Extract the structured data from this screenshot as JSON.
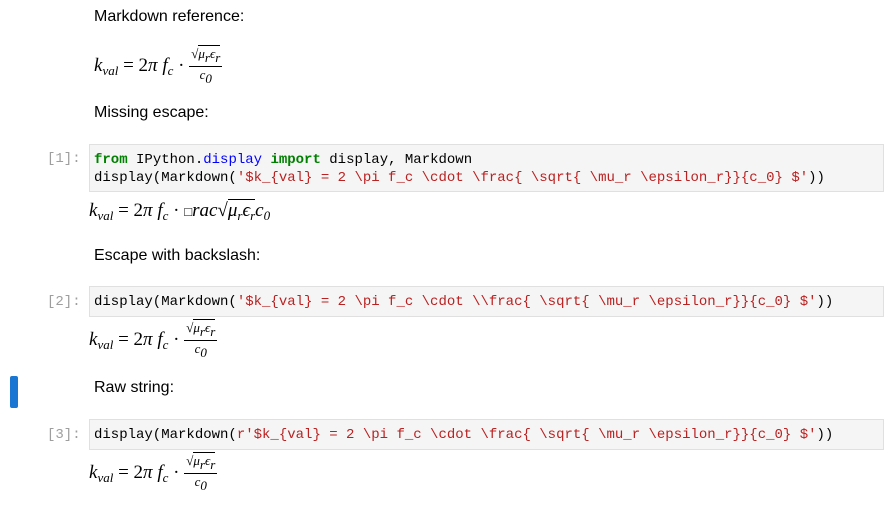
{
  "cells": [
    {
      "kind": "markdown",
      "text": "Markdown reference:"
    },
    {
      "kind": "markdown",
      "text": "Missing escape:"
    },
    {
      "kind": "code",
      "prompt": "[1]:",
      "line1": {
        "kw_from": "from",
        "module_a": "IPython.",
        "module_b": "display",
        "kw_import": "import",
        "names": "display, Markdown"
      },
      "line2": {
        "call_open": "display(Markdown(",
        "string": "'$k_{val} = 2 \\pi f_c \\cdot \\frac{ \\sqrt{ \\mu_r \\epsilon_r}}{c_0} $'",
        "call_close": "))"
      }
    },
    {
      "kind": "markdown",
      "text": "Escape with backslash:"
    },
    {
      "kind": "code",
      "prompt": "[2]:",
      "line1": {
        "call_open": "display(Markdown(",
        "string": "'$k_{val} = 2 \\pi f_c \\cdot \\\\frac{ \\sqrt{ \\mu_r \\epsilon_r}}{c_0} $'",
        "call_close": "))"
      }
    },
    {
      "kind": "markdown",
      "text": "Raw string:"
    },
    {
      "kind": "code",
      "prompt": "[3]:",
      "line1": {
        "call_open": "display(Markdown(",
        "string": "r'$k_{val} = 2 \\pi f_c \\cdot \\frac{ \\sqrt{ \\mu_r \\epsilon_r}}{c_0} $'",
        "call_close": "))"
      }
    }
  ],
  "math": {
    "k": "k",
    "sub_val": "val",
    "eq": "= 2",
    "pi": "π",
    "f": "f",
    "sub_c": "c",
    "cdot": "·",
    "sqrt_sym": "√",
    "mu": "μ",
    "sub_r": "r",
    "eps": "ϵ",
    "c0": "c",
    "sub_0": "0",
    "missing_glyph": "□",
    "rac": "rac"
  },
  "selection_color": "#1976d2"
}
